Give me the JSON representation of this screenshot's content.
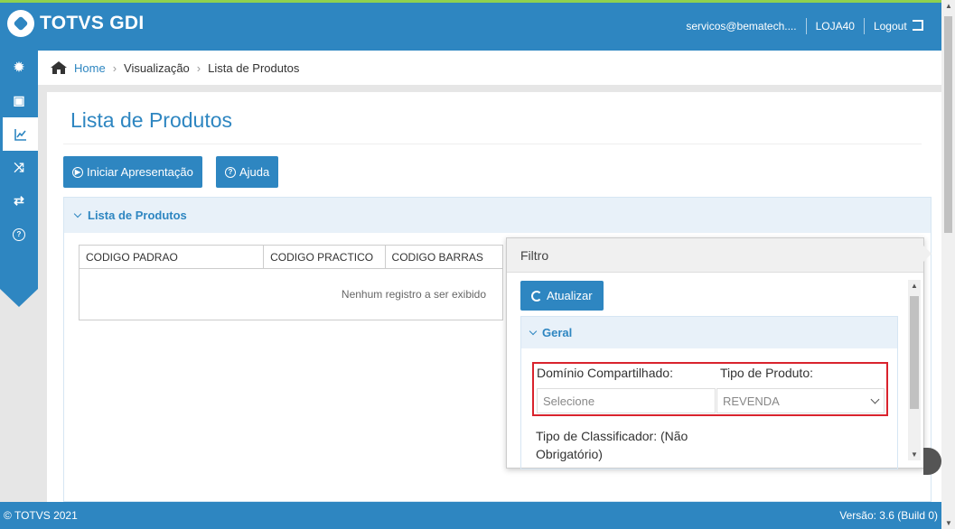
{
  "header": {
    "logo_text": "TOTVS GDI",
    "user_email": "servicos@bematech....",
    "store": "LOJA40",
    "logout_label": "Logout"
  },
  "sidebar": {
    "items": [
      {
        "icon": "gear-icon",
        "glyph": "✹"
      },
      {
        "icon": "book-icon",
        "glyph": "▣"
      },
      {
        "icon": "chart-icon",
        "glyph": "📈"
      },
      {
        "icon": "shuffle-icon",
        "glyph": "⤨"
      },
      {
        "icon": "retweet-icon",
        "glyph": "⇄"
      },
      {
        "icon": "help-icon",
        "glyph": "?"
      }
    ]
  },
  "breadcrumb": {
    "home": "Home",
    "sep": "›",
    "item1": "Visualização",
    "item2": "Lista de Produtos"
  },
  "main": {
    "title": "Lista de Produtos",
    "btn_presentation": "Iniciar Apresentação",
    "btn_help": "Ajuda",
    "panel_title": "Lista de Produtos",
    "table": {
      "columns": [
        "CODIGO PADRAO",
        "CODIGO PRACTICO",
        "CODIGO BARRAS"
      ],
      "empty_message": "Nenhum registro a ser exibido"
    }
  },
  "filter": {
    "title": "Filtro",
    "refresh_button": "Atualizar",
    "section_title": "Geral",
    "dominio_label": "Domínio Compartilhado:",
    "dominio_value": "Selecione",
    "tipo_label": "Tipo de Produto:",
    "tipo_value": "REVENDA",
    "classificador_label": "Tipo de Classificador: (Não Obrigatório)"
  },
  "footer": {
    "copyright": "© TOTVS 2021",
    "version": "Versão: 3.6 (Build 0)"
  },
  "colors": {
    "primary": "#2e86c1",
    "accent_green": "#8fd14f",
    "highlight_red": "#d9232d"
  }
}
